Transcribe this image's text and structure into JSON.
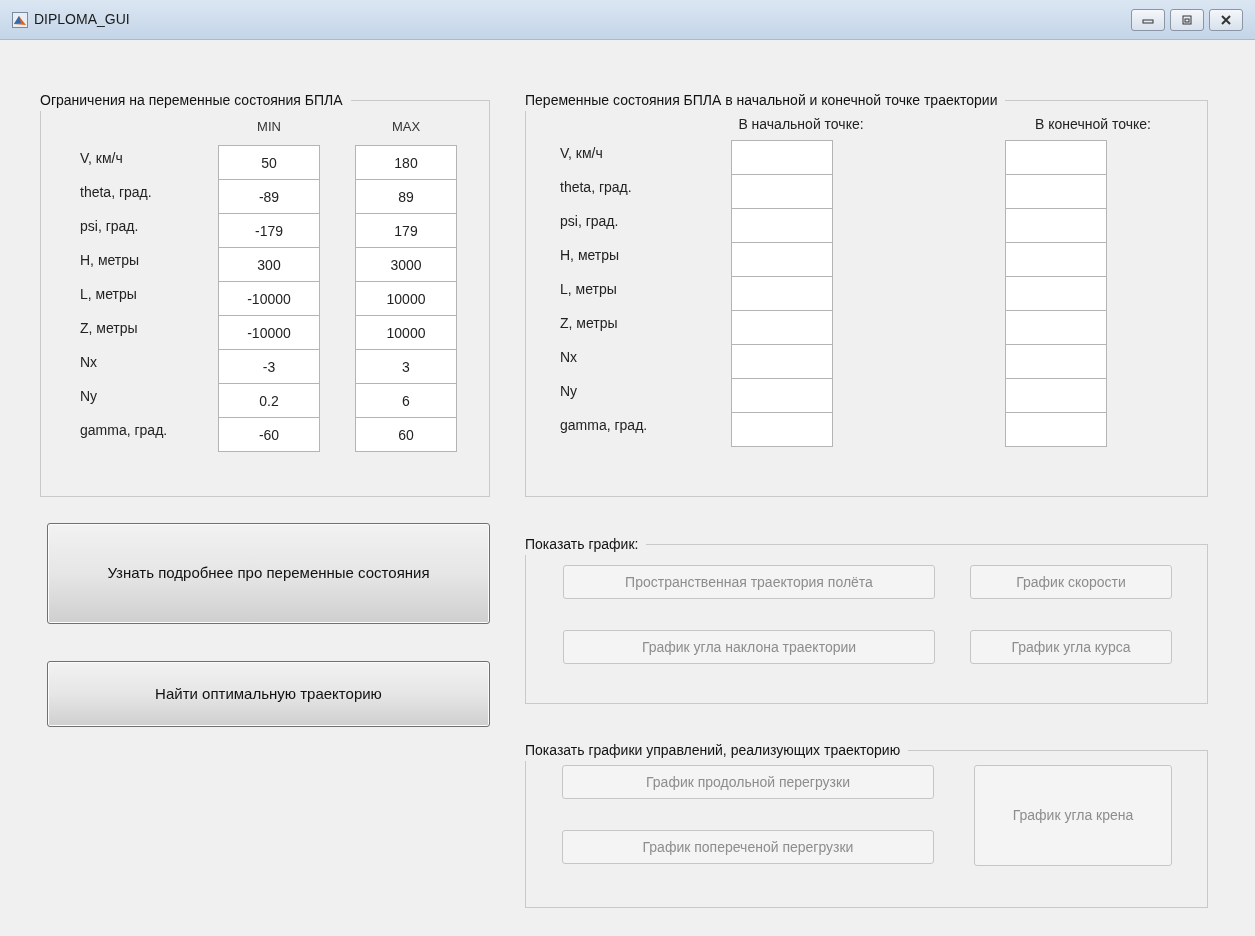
{
  "window": {
    "title": "DIPLOMA_GUI"
  },
  "constraints": {
    "title": "Ограничения на переменные состояния БПЛА",
    "headers": [
      "MIN",
      "MAX"
    ],
    "rows": [
      {
        "label": "V, км/ч",
        "min": "50",
        "max": "180"
      },
      {
        "label": "theta, град.",
        "min": "-89",
        "max": "89"
      },
      {
        "label": "psi, град.",
        "min": "-179",
        "max": "179"
      },
      {
        "label": "H, метры",
        "min": "300",
        "max": "3000"
      },
      {
        "label": "L, метры",
        "min": "-10000",
        "max": "10000"
      },
      {
        "label": "Z, метры",
        "min": "-10000",
        "max": "10000"
      },
      {
        "label": "Nx",
        "min": "-3",
        "max": "3"
      },
      {
        "label": "Ny",
        "min": "0.2",
        "max": "6"
      },
      {
        "label": "gamma, град.",
        "min": "-60",
        "max": "60"
      }
    ]
  },
  "endpoints": {
    "title": "Переменные состояния БПЛА в начальной и конечной точке траектории",
    "headers": [
      "В начальной точке:",
      "В конечной точке:"
    ],
    "rows": [
      {
        "label": "V, км/ч"
      },
      {
        "label": "theta, град."
      },
      {
        "label": "psi, град."
      },
      {
        "label": "H, метры"
      },
      {
        "label": "L, метры"
      },
      {
        "label": "Z, метры"
      },
      {
        "label": "Nx"
      },
      {
        "label": "Ny"
      },
      {
        "label": "gamma, град."
      }
    ]
  },
  "actions": [
    {
      "label": "Узнать подробнее про переменные состояния",
      "disabled": false
    },
    {
      "label": "Найти оптимальную траекторию",
      "disabled": false
    }
  ],
  "plots": {
    "title": "Показать график:",
    "buttons": [
      {
        "label": "Пространственная траектория полёта",
        "disabled": true
      },
      {
        "label": "График скорости",
        "disabled": true
      },
      {
        "label": "График угла наклона траектории",
        "disabled": true
      },
      {
        "label": "График угла курса",
        "disabled": true
      }
    ]
  },
  "controls": {
    "title": "Показать графики управлений, реализующих траекторию",
    "buttons": [
      {
        "label": "График продольной перегрузки",
        "disabled": true
      },
      {
        "label": "График попереченой перегрузки",
        "disabled": true
      },
      {
        "label": "График угла крена",
        "disabled": true
      }
    ]
  }
}
